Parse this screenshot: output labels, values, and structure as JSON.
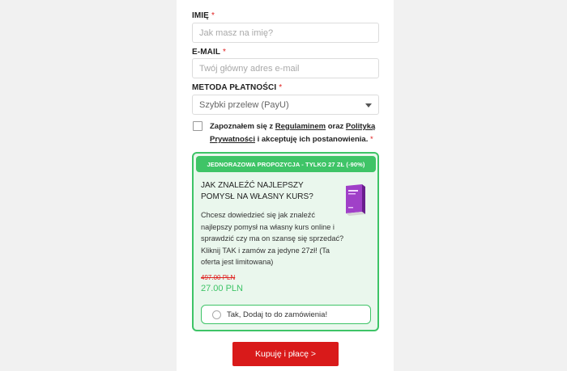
{
  "form": {
    "name_label": "IMIĘ",
    "name_placeholder": "Jak masz na imię?",
    "email_label": "E-MAIL",
    "email_placeholder": "Twój główny adres e-mail",
    "payment_label": "METODA PŁATNOŚCI",
    "payment_selected": "Szybki przelew (PayU)",
    "required_mark": "*"
  },
  "terms": {
    "prefix": "Zapoznałem się z ",
    "regulations_link": "Regulaminem",
    "middle": " oraz ",
    "privacy_link": "Polityką Prywatności",
    "suffix": " i akceptuję ich postanowienia. ",
    "required_mark": "*",
    "checked": false
  },
  "offer": {
    "banner": "JEDNORAZOWA PROPOZYCJA - TYLKO 27 ZŁ (-90%)",
    "title": "JAK ZNALEŹĆ NAJLEPSZY POMYSŁ NA WŁASNY KURS?",
    "description": "Chcesz dowiedzieć się jak znaleźć najlepszy pomysł na własny kurs online i sprawdzić czy ma on szansę się sprzedać? Kliknij TAK i zamów za jedyne 27zł! (Ta oferta jest limitowana)",
    "old_price": "497.00 PLN",
    "new_price": "27.00 PLN",
    "accept_label": "Tak, Dodaj to do zamówienia!",
    "accepted": false
  },
  "buy_button": "Kupuję i płacę >",
  "colors": {
    "accent_green": "#3ec467",
    "required_red": "#e0201f",
    "buy_red": "#d91a1a",
    "offer_bg": "#eaf7ed"
  },
  "icons": {
    "book": "ebook-cover-icon",
    "dropdown": "chevron-down-icon"
  }
}
